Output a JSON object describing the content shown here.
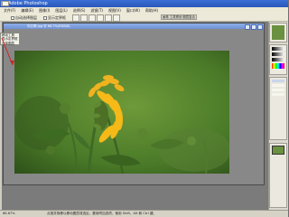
{
  "app": {
    "title": "Adobe Photoshop"
  },
  "menu": {
    "items": [
      "文件(F)",
      "编辑(E)",
      "图像(I)",
      "图层(L)",
      "选择(S)",
      "滤镜(T)",
      "视图(V)",
      "窗口(W)",
      "帮助(H)"
    ]
  },
  "options": {
    "auto_select_label": "自动选择图层",
    "show_bounds_label": "显示定界框"
  },
  "panel_well": {
    "tabs": [
      "画笔",
      "工具预设",
      "图层复合"
    ]
  },
  "document": {
    "title": "向日葵.jpg @ 66.7%(RGB/8)"
  },
  "tooltip": {
    "lines": [
      "移动工具",
      "显示定界框",
      "选择图层"
    ]
  },
  "status": {
    "zoom": "66.67%",
    "text": "点按并拖移以移动图层或选区。要用附加选项，使用 Shift、Alt 和 Ctrl 键。"
  },
  "colors": {
    "titlebar": "#2a56b8",
    "workspace": "#7b7b7b",
    "arrow": "#cc2222"
  }
}
